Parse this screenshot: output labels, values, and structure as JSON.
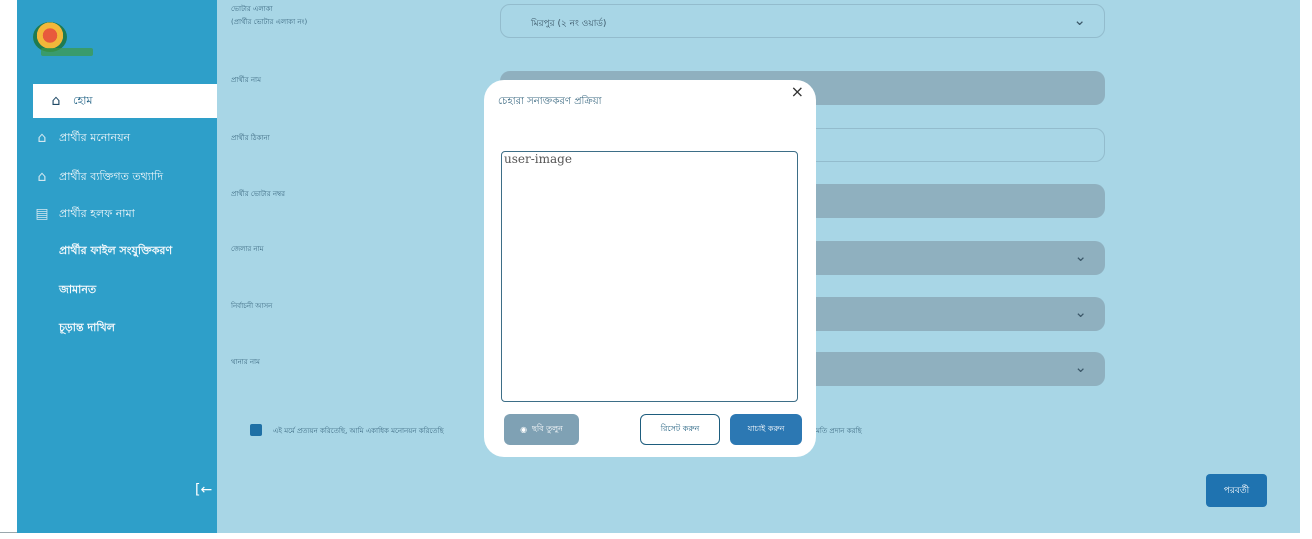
{
  "sidebar": {
    "items": [
      {
        "label": "হোম",
        "icon": "home-icon"
      },
      {
        "label": "প্রার্থীর মনোনয়ন",
        "icon": "building-icon"
      },
      {
        "label": "প্রার্থীর ব্যক্তিগত তথ্যাদি",
        "icon": "building-icon"
      },
      {
        "label": "প্রার্থীর হলফ নামা",
        "icon": "document-icon"
      },
      {
        "label": "প্রার্থীর ফাইল সংযুক্তিকরণ"
      },
      {
        "label": "জামানত"
      },
      {
        "label": "চূড়ান্ত দাখিল"
      }
    ],
    "collapse_glyph": "[←"
  },
  "form": {
    "constituency_label": "ভোটার এলাকা",
    "constituency_hint": "(প্রার্থীর ভোটার এলাকা নং)",
    "constituency_value": "মিরপুর (২ নং ওয়ার্ড)",
    "name_label": "প্রার্থীর নাম",
    "address_label": "প্রার্থীর ঠিকানা",
    "voter_no_label": "প্রার্থীর ভোটার নম্বর",
    "district_label": "জেলার নাম",
    "upazila_label": "নির্বাচনী আসন",
    "thana_label": "থানার নাম",
    "agree_text": "এই মর্মে প্রত্যয়ন করিতেছি, আমি একাধিক মনোনয়ন করিতেছি",
    "agree_text_tail": "মতি প্রদান করছি",
    "next_label": "পরবর্তী"
  },
  "modal": {
    "title": "চেহারা সনাক্তকরণ প্রক্রিয়া",
    "close_glyph": "×",
    "camera_alt": "user-image",
    "capture_label": "ছবি তুলুন",
    "reset_label": "রিসেট করুন",
    "verify_label": "যাচাই করুন"
  },
  "colors": {
    "sidebar": "#2e9fc9",
    "overlay": "#a8d6e6",
    "primary": "#1f73b0"
  }
}
